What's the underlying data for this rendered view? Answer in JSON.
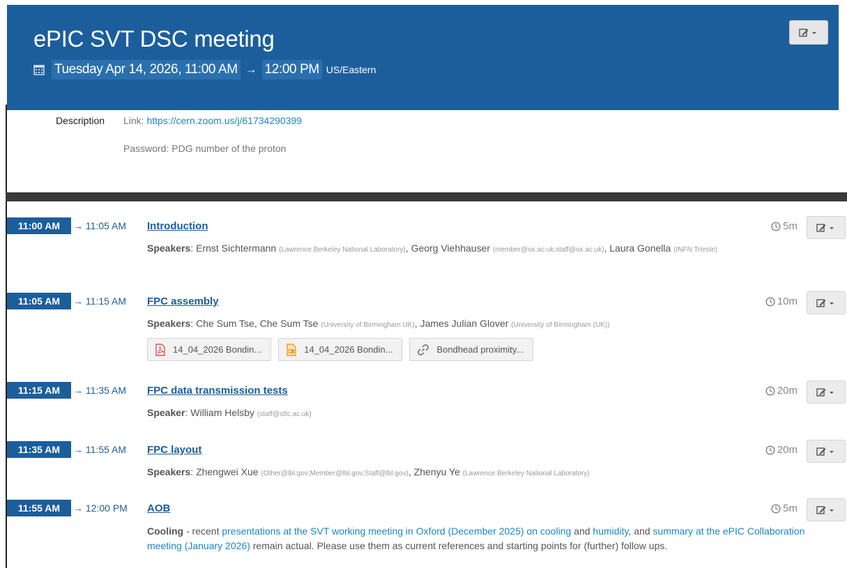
{
  "event": {
    "title": "ePIC SVT DSC meeting",
    "start": "Tuesday Apr 14, 2026, 11:00 AM",
    "arrow": "→",
    "end": "12:00 PM",
    "timezone": "US/Eastern"
  },
  "description": {
    "label": "Description",
    "link_prefix": "Link: ",
    "link": "https://cern.zoom.us/j/61734290399",
    "password": "Password: PDG number of the proton"
  },
  "entries": [
    {
      "start": "11:00 AM",
      "end": "→ 11:05 AM",
      "title": "Introduction",
      "duration": "5m",
      "speakers_label": "Speakers",
      "speakers": [
        {
          "name": "Ernst Sichtermann",
          "affil": "(Lawrence Berkeley National Laboratory)"
        },
        {
          "name": "Georg Viehhauser",
          "affil": "(member@ox.ac.uk;staff@ox.ac.uk)"
        },
        {
          "name": "Laura Gonella",
          "affil": "(INFN Trieste)"
        }
      ]
    },
    {
      "start": "11:05 AM",
      "end": "→ 11:15 AM",
      "title": "FPC assembly",
      "duration": "10m",
      "speakers_label": "Speakers",
      "speakers": [
        {
          "name": "Che Sum Tse",
          "affil": ""
        },
        {
          "name": "Che Sum Tse",
          "affil": "(University of Birmingham UK)"
        },
        {
          "name": "James Julian Glover",
          "affil": "(University of Birmingham (UK))"
        }
      ],
      "attachments": [
        {
          "icon": "pdf-file-icon",
          "label": "14_04_2026 Bondin..."
        },
        {
          "icon": "presentation-file-icon",
          "label": "14_04_2026 Bondin..."
        },
        {
          "icon": "link-icon",
          "label": "Bondhead proximity..."
        }
      ]
    },
    {
      "start": "11:15 AM",
      "end": "→ 11:35 AM",
      "title": "FPC data transmission tests",
      "duration": "20m",
      "speakers_label": "Speaker",
      "speakers": [
        {
          "name": "William Helsby",
          "affil": "(staff@stfc.ac.uk)"
        }
      ]
    },
    {
      "start": "11:35 AM",
      "end": "→ 11:55 AM",
      "title": "FPC layout",
      "duration": "20m",
      "speakers_label": "Speakers",
      "speakers": [
        {
          "name": "Zhengwei Xue",
          "affil": "(Other@lbl.gov;Member@lbl.gov;Staff@lbl.gov)"
        },
        {
          "name": "Zhenyu Ye",
          "affil": "(Lawrence Berkeley National Laboratory)"
        }
      ]
    },
    {
      "start": "11:55 AM",
      "end": "→ 12:00 PM",
      "title": "AOB",
      "duration": "5m",
      "aob": {
        "bold": "Cooling",
        "t1": " - recent ",
        "link1": "presentations at the SVT working meeting in Oxford (December 2025) on cooling",
        "t2": " and ",
        "link2": "humidity",
        "t3": ", and ",
        "link3": "summary at the ePIC Collaboration meeting (January 2026)",
        "t4": " remain actual. Please use them as current references and starting points for (further) follow ups."
      }
    }
  ],
  "colors": {
    "header": "#1c5e9c",
    "link": "#1a87c8",
    "bar": "#3a3a3a"
  }
}
